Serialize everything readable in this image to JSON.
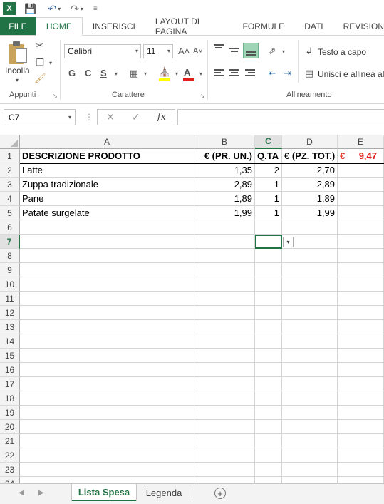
{
  "qat": {
    "app_icon": "X",
    "save_icon": "save-icon",
    "undo_icon": "undo-icon",
    "redo_icon": "redo-icon",
    "customize_icon": "customize-icon"
  },
  "tabs": [
    "FILE",
    "HOME",
    "INSERISCI",
    "LAYOUT DI PAGINA",
    "FORMULE",
    "DATI",
    "REVISION"
  ],
  "active_tab": "HOME",
  "ribbon": {
    "paste_label": "Incolla",
    "clipboard_label": "Appunti",
    "font_name": "Calibri",
    "font_size": "11",
    "grow_font": "A˄",
    "shrink_font": "A˅",
    "bold": "G",
    "italic": "C",
    "underline": "S",
    "font_group_label": "Carattere",
    "wrap_text": "Testo a capo",
    "merge_center": "Unisci e allinea al",
    "alignment_label": "Allineamento"
  },
  "formula_bar": {
    "name_box": "C7",
    "cancel": "✕",
    "enter": "✓",
    "fx": "fx",
    "formula": ""
  },
  "sheet": {
    "columns": [
      "A",
      "B",
      "C",
      "D",
      "E"
    ],
    "selected_column": "C",
    "selected_row": "7",
    "row_numbers": [
      "1",
      "2",
      "3",
      "4",
      "5",
      "6",
      "7",
      "8",
      "9",
      "10",
      "11",
      "12",
      "13",
      "14",
      "15",
      "16",
      "17",
      "18",
      "19",
      "20",
      "21",
      "22",
      "23",
      "24"
    ],
    "header": {
      "a": "DESCRIZIONE PRODOTTO",
      "b": "€ (PR. UN.)",
      "c": "Q.TA",
      "d": "€ (PZ. TOT.)",
      "e_currency": "€",
      "e_value": "9,47"
    },
    "rows": [
      {
        "a": "Latte",
        "b": "1,35",
        "c": "2",
        "d": "2,70"
      },
      {
        "a": "Zuppa tradizionale",
        "b": "2,89",
        "c": "1",
        "d": "2,89"
      },
      {
        "a": "Pane",
        "b": "1,89",
        "c": "1",
        "d": "1,89"
      },
      {
        "a": "Patate surgelate",
        "b": "1,99",
        "c": "1",
        "d": "1,99"
      }
    ]
  },
  "sheet_tabs": [
    "Lista Spesa",
    "Legenda"
  ],
  "active_sheet": "Lista Spesa",
  "colors": {
    "excel_green": "#217346",
    "total_red": "#e0211b"
  }
}
